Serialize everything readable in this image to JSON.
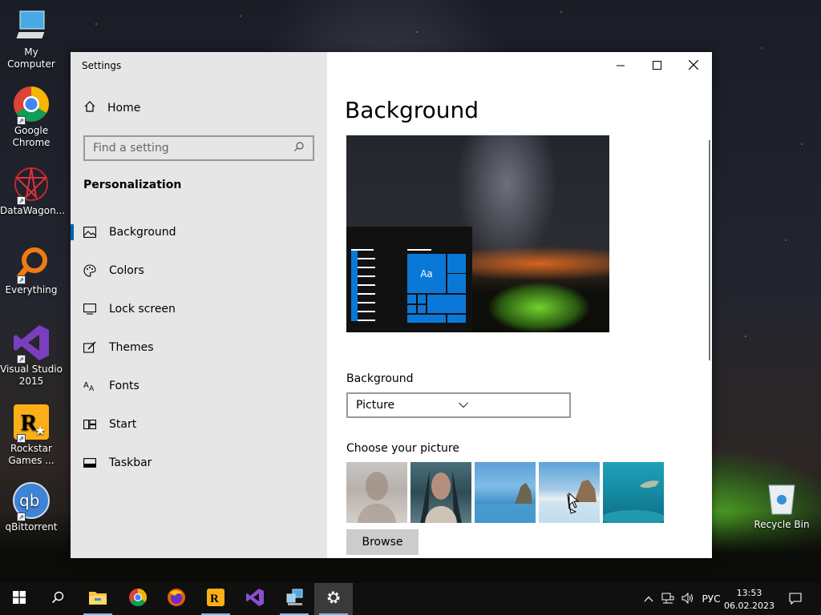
{
  "desktop": {
    "icons": [
      {
        "label": "My Computer"
      },
      {
        "label": "Google Chrome"
      },
      {
        "label": "DataWagon..."
      },
      {
        "label": "Everything"
      },
      {
        "label": "Visual Studio 2015"
      },
      {
        "label": "Rockstar Games ..."
      },
      {
        "label": "qBittorrent"
      }
    ],
    "recycle_bin": "Recycle Bin"
  },
  "window": {
    "title": "Settings",
    "controls": {
      "minimize": "minimize-icon",
      "maximize": "maximize-icon",
      "close": "close-icon"
    }
  },
  "sidebar": {
    "home": "Home",
    "search_placeholder": "Find a setting",
    "section": "Personalization",
    "items": [
      {
        "label": "Background",
        "icon": "picture-icon",
        "active": true
      },
      {
        "label": "Colors",
        "icon": "palette-icon"
      },
      {
        "label": "Lock screen",
        "icon": "lock-screen-icon"
      },
      {
        "label": "Themes",
        "icon": "themes-icon"
      },
      {
        "label": "Fonts",
        "icon": "fonts-icon"
      },
      {
        "label": "Start",
        "icon": "start-icon"
      },
      {
        "label": "Taskbar",
        "icon": "taskbar-icon"
      }
    ]
  },
  "main": {
    "title": "Background",
    "preview_tile_text": "Aa",
    "background_label": "Background",
    "background_value": "Picture",
    "choose_label": "Choose your picture",
    "browse": "Browse"
  },
  "taskbar": {
    "language": "РУС",
    "time": "13:53",
    "date": "06.02.2023",
    "accent": "#76b9ed"
  }
}
